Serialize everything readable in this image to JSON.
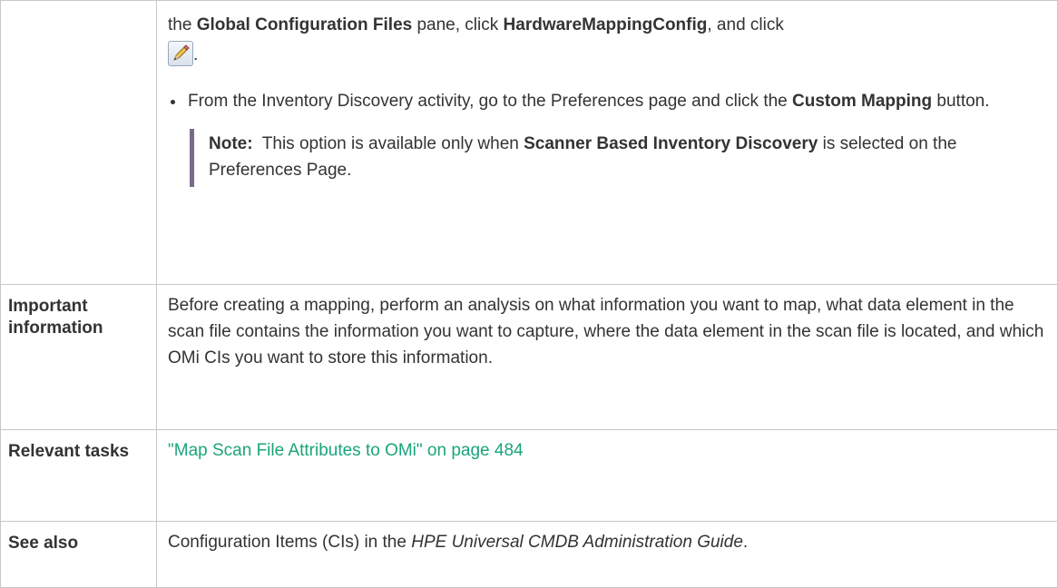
{
  "rows": [
    {
      "label": "",
      "line1_pre": "the ",
      "line1_b1": "Global Configuration Files",
      "line1_mid": " pane, click ",
      "line1_b2": "HardwareMappingConfig",
      "line1_post": ", and click",
      "icon": "pencil-edit-icon",
      "period": ".",
      "bullet_pre": "From the Inventory Discovery activity, go to the Preferences page and click the ",
      "bullet_b": "Custom Mapping",
      "bullet_post": " button.",
      "note_label": "Note:",
      "note_pre": "  This option is available only when ",
      "note_b": "Scanner Based Inventory Discovery",
      "note_post": " is selected on the Preferences Page."
    },
    {
      "label": "Important information",
      "text": "Before creating a mapping, perform an analysis on what information you want to map, what data element in the scan file contains the information you want to capture, where the data element in the scan file is located, and which OMi CIs you want to store this information."
    },
    {
      "label": "Relevant tasks",
      "link": "\"Map Scan File Attributes to OMi\" on page 484"
    },
    {
      "label": "See also",
      "pre": "Configuration Items (CIs) in the ",
      "italic": "HPE Universal CMDB Administration Guide",
      "post": "."
    }
  ]
}
